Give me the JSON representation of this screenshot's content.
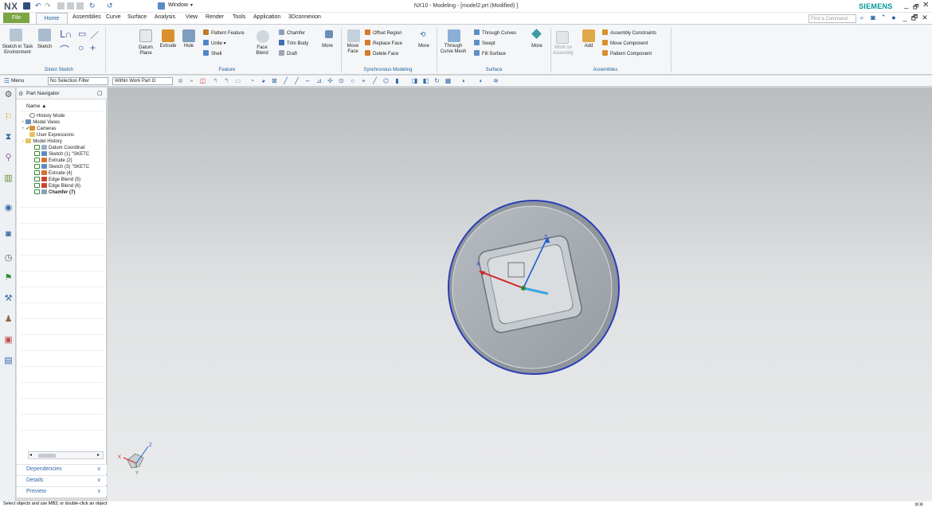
{
  "title_bar": {
    "logo": "NX",
    "window_menu": "Window",
    "title": "NX10 - Modeling - [model2.prt (Modified) ]",
    "brand": "SIEMENS"
  },
  "menu_tabs": {
    "file": "File",
    "tabs": [
      "Home",
      "Assemblies",
      "Curve",
      "Surface",
      "Analysis",
      "View",
      "Render",
      "Tools",
      "Application",
      "3Dconnexion"
    ],
    "command_search_placeholder": "Find a Command"
  },
  "ribbon": {
    "direct_sketch": {
      "sketch_in_task": "Sketch in Task Environment",
      "sketch": "Sketch",
      "group": "Direct Sketch"
    },
    "feature": {
      "datum_plane": "Datum Plane",
      "extrude": "Extrude",
      "hole": "Hole",
      "pattern_feature": "Pattern Feature",
      "unite": "Unite",
      "shell": "Shell",
      "face_blend": "Face Blend",
      "chamfer": "Chamfer",
      "trim_body": "Trim Body",
      "draft": "Draft",
      "more": "More",
      "group": "Feature"
    },
    "sync": {
      "move_face": "Move Face",
      "offset_region": "Offset Region",
      "replace_face": "Replace Face",
      "delete_face": "Delete Face",
      "more": "More",
      "group": "Synchronous Modeling"
    },
    "surface": {
      "through_curve_mesh": "Through Curve Mesh",
      "through_curves": "Through Curves",
      "swept": "Swept",
      "fill_surface": "Fill Surface",
      "more": "More",
      "group": "Surface"
    },
    "assemblies": {
      "work_on_assembly": "Work on Assembly",
      "add": "Add",
      "assembly_constraints": "Assembly Constraints",
      "move_component": "Move Component",
      "pattern_component": "Pattern Component",
      "group": "Assemblies"
    }
  },
  "selection_bar": {
    "menu": "Menu",
    "filter": "No Selection Filter",
    "scope": "Within Work Part O"
  },
  "part_navigator": {
    "title": "Part Navigator",
    "column": "Name",
    "items": [
      {
        "label": "History Mode",
        "icon": "clock-icon"
      },
      {
        "label": "Model Views",
        "icon": "views-icon"
      },
      {
        "label": "Cameras",
        "icon": "camera-icon"
      },
      {
        "label": "User Expressions",
        "icon": "folder-icon"
      },
      {
        "label": "Model History",
        "icon": "folder-icon"
      },
      {
        "label": "Datum Coordinat",
        "icon": "datum-icon"
      },
      {
        "label": "Sketch (1) \"SKETC",
        "icon": "sketch-icon"
      },
      {
        "label": "Extrude (2)",
        "icon": "extrude-icon"
      },
      {
        "label": "Sketch (3) \"SKETC",
        "icon": "sketch-icon"
      },
      {
        "label": "Extrude (4)",
        "icon": "extrude-icon"
      },
      {
        "label": "Edge Blend (5)",
        "icon": "blend-icon"
      },
      {
        "label": "Edge Blend (6)",
        "icon": "blend-icon"
      },
      {
        "label": "Chamfer (7)",
        "icon": "chamfer-icon"
      }
    ],
    "panels": [
      "Dependencies",
      "Details",
      "Preview"
    ]
  },
  "viewport": {
    "axes": {
      "x": "X",
      "y": "Y",
      "z": "Z"
    }
  },
  "status": "Select objects and use MB3, or double-click an object",
  "colors": {
    "file_tab": "#7aa542",
    "brand": "#009999",
    "accent": "#1c5e9a",
    "part_body": "#aab0b5",
    "part_edges": "#2a3db8"
  }
}
